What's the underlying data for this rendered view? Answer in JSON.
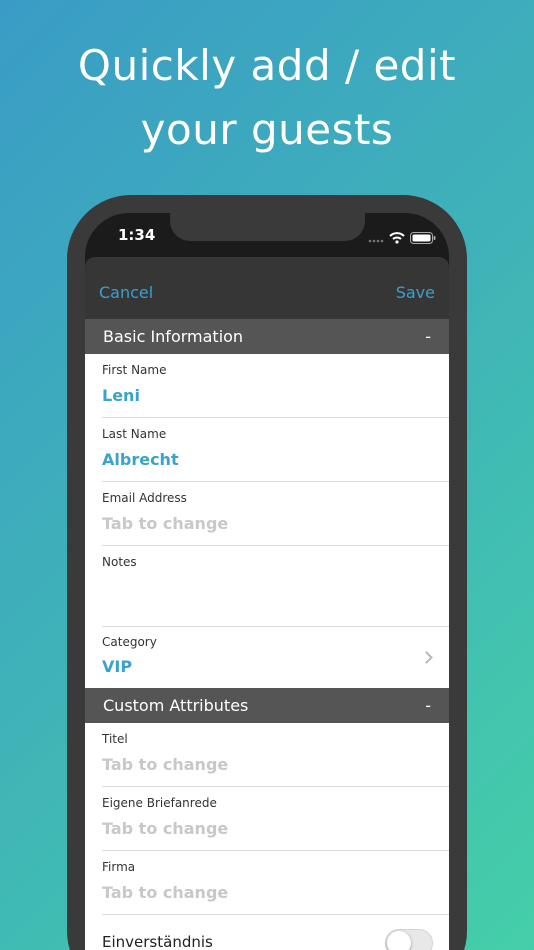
{
  "headline": {
    "line1": "Quickly add / edit",
    "line2": "your guests"
  },
  "status_bar": {
    "time": "1:34"
  },
  "nav": {
    "cancel": "Cancel",
    "save": "Save"
  },
  "basic_section": {
    "title": "Basic Information",
    "collapse": "-",
    "fields": [
      {
        "label": "First Name",
        "value": "Leni"
      },
      {
        "label": "Last Name",
        "value": "Albrecht"
      },
      {
        "label": "Email Address",
        "placeholder": "Tab to change"
      },
      {
        "label": "Notes",
        "value": ""
      },
      {
        "label": "Category",
        "value": "VIP"
      }
    ]
  },
  "custom_section": {
    "title": "Custom Attributes",
    "collapse": "-",
    "fields": [
      {
        "label": "Titel",
        "placeholder": "Tab to change"
      },
      {
        "label": "Eigene Briefanrede",
        "placeholder": "Tab to change"
      },
      {
        "label": "Firma",
        "placeholder": "Tab to change"
      }
    ],
    "toggle": {
      "label": "Einverständnis",
      "state": "off"
    }
  }
}
